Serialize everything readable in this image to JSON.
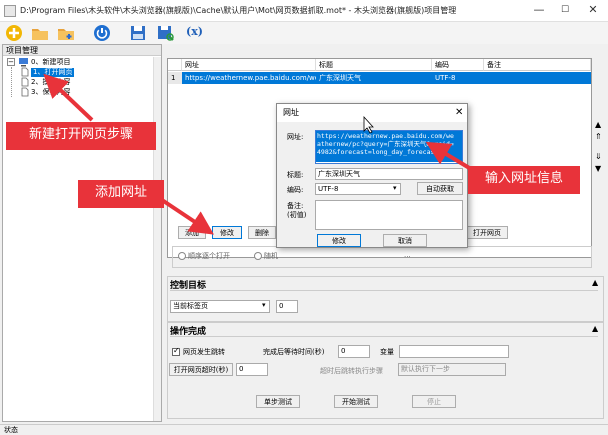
{
  "window": {
    "title": "D:\\Program Files\\木头软件\\木头浏览器(旗舰版)\\Cache\\默认用户\\Mot\\网页数据抓取.mot* - 木头浏览器(旗舰版)项目管理",
    "minimize": "—",
    "maximize": "☐",
    "close": "✕"
  },
  "toolbar": {
    "regex_label": "(x)"
  },
  "tree": {
    "header": "项目管理",
    "root_label": "0、新建项目",
    "items": [
      "1、打开网页",
      "2、摸取内容",
      "3、保存内容"
    ]
  },
  "grid": {
    "columns": [
      "网址",
      "标题",
      "编码",
      "备注"
    ],
    "rows": [
      {
        "index": "1",
        "url": "https://weathernew.pae.baidu.com/weathernew/pc?query=广东深圳天气&srcid=4982&forecast=long_day_forecast",
        "title": "广东深圳天气",
        "encoding": "UTF-8",
        "note": ""
      }
    ]
  },
  "buttons_row": {
    "add": "添加",
    "edit": "修改",
    "delete": "删除",
    "open_page": "打开网页"
  },
  "order_options": {
    "sequential": "顺序逐个打开",
    "random": "随机",
    "others": "..."
  },
  "control_target": {
    "title": "控制目标",
    "tab_select": "当前标签页",
    "tab_index": "0"
  },
  "completion": {
    "title": "操作完成",
    "page_jump_label": "网页发生跳转",
    "wait_label": "完成后等待时间(秒)",
    "wait_value": "0",
    "variable_label": "变量",
    "variable_value": "",
    "timeout_button": "打开网页超时(秒)",
    "timeout_value": "0",
    "after_timeout_label": "超时后跳转执行步骤",
    "after_timeout_value": "默认执行下一步"
  },
  "bottom_buttons": {
    "step_test": "单步测试",
    "start_test": "开始测试",
    "stop": "停止"
  },
  "dialog": {
    "title": "网址",
    "url_label": "网址:",
    "url_value": "https://weathernew.pae.baidu.com/weathernew/pc?query=广东深圳天气&srcid=4982&forecast=long_day_forecast",
    "title_label": "标题:",
    "title_value": "广东深圳天气",
    "encoding_label": "编码:",
    "encoding_value": "UTF-8",
    "auto_detect": "自动获取",
    "note_label": "备注:\n(初值)",
    "note_value": "",
    "ok": "修改",
    "cancel": "取消"
  },
  "callouts": {
    "new_open_step": "新建打开网页步骤",
    "add_url": "添加网址",
    "input_url_info": "输入网址信息"
  },
  "status": {
    "text": "状态"
  },
  "colors": {
    "callout_red": "#e8333a",
    "selection_blue": "#0078d7",
    "arrow_red": "#e8333a"
  }
}
